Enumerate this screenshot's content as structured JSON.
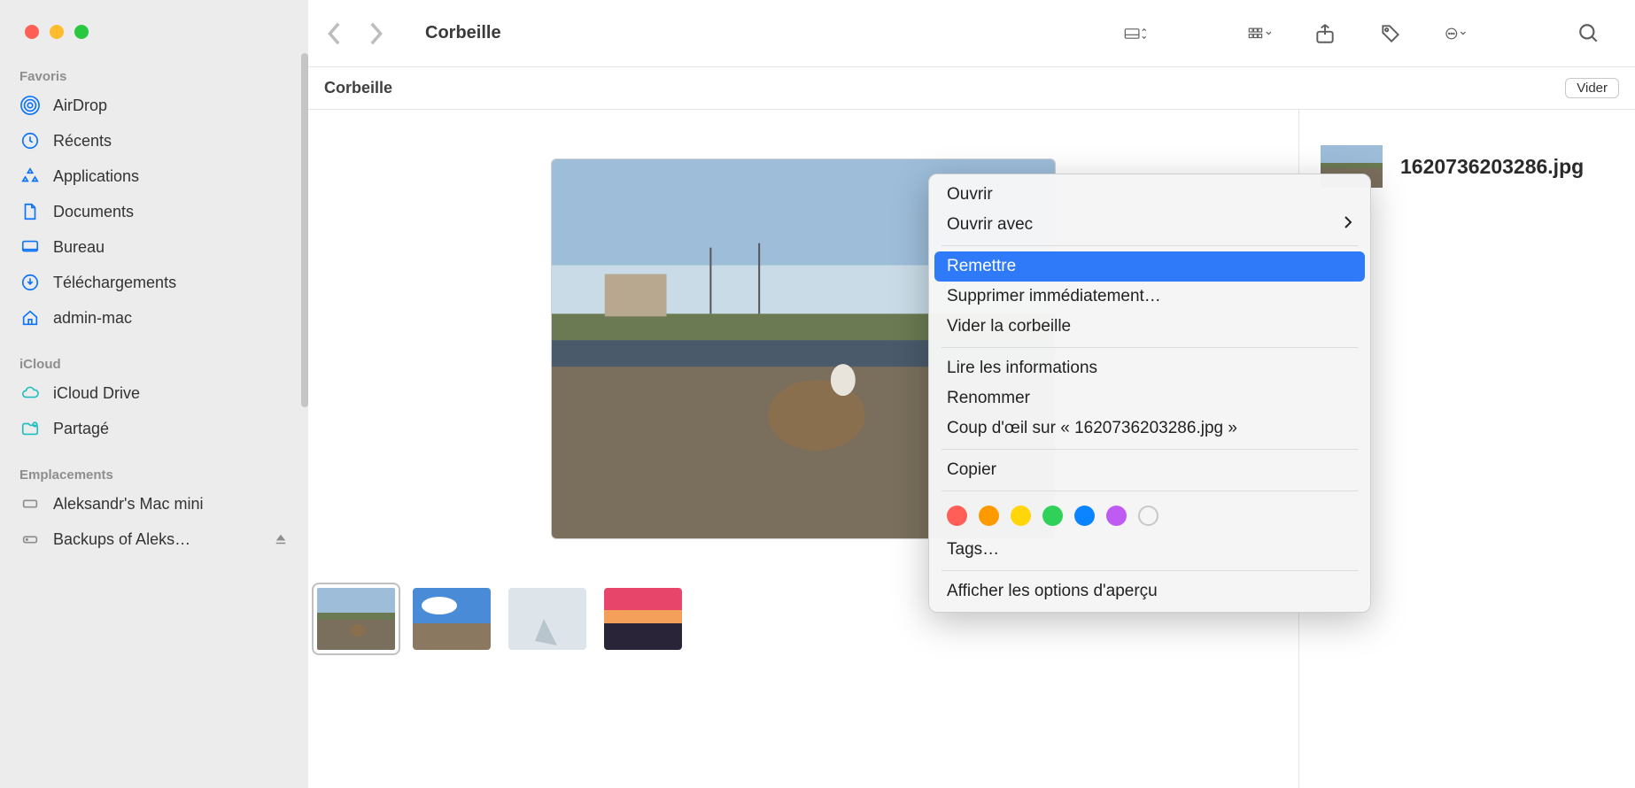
{
  "window_title": "Corbeille",
  "path_bar_title": "Corbeille",
  "empty_button": "Vider",
  "sidebar": {
    "sections": [
      {
        "label": "Favoris",
        "items": [
          {
            "icon": "airdrop",
            "label": "AirDrop"
          },
          {
            "icon": "clock",
            "label": "Récents"
          },
          {
            "icon": "apps",
            "label": "Applications"
          },
          {
            "icon": "doc",
            "label": "Documents"
          },
          {
            "icon": "desktop",
            "label": "Bureau"
          },
          {
            "icon": "download",
            "label": "Téléchargements"
          },
          {
            "icon": "house",
            "label": "admin-mac"
          }
        ]
      },
      {
        "label": "iCloud",
        "items": [
          {
            "icon": "cloud",
            "label": "iCloud Drive"
          },
          {
            "icon": "shared",
            "label": "Partagé"
          }
        ]
      },
      {
        "label": "Emplacements",
        "items": [
          {
            "icon": "computer",
            "label": "Aleksandr's Mac mini"
          },
          {
            "icon": "disk",
            "label": "Backups of Aleks…",
            "eject": true
          }
        ]
      }
    ]
  },
  "inspector": {
    "filename": "1620736203286.jpg"
  },
  "context_menu": {
    "open": "Ouvrir",
    "open_with": "Ouvrir avec",
    "put_back": "Remettre",
    "delete_now": "Supprimer immédiatement…",
    "empty_trash": "Vider la corbeille",
    "get_info": "Lire les informations",
    "rename": "Renommer",
    "quick_look": "Coup d'œil sur « 1620736203286.jpg »",
    "copy": "Copier",
    "tags": "Tags…",
    "show_preview_options": "Afficher les options d'aperçu",
    "colors": [
      "#ff5f57",
      "#fd9a00",
      "#ffd60a",
      "#30d158",
      "#0a84ff",
      "#bf5af2"
    ]
  }
}
